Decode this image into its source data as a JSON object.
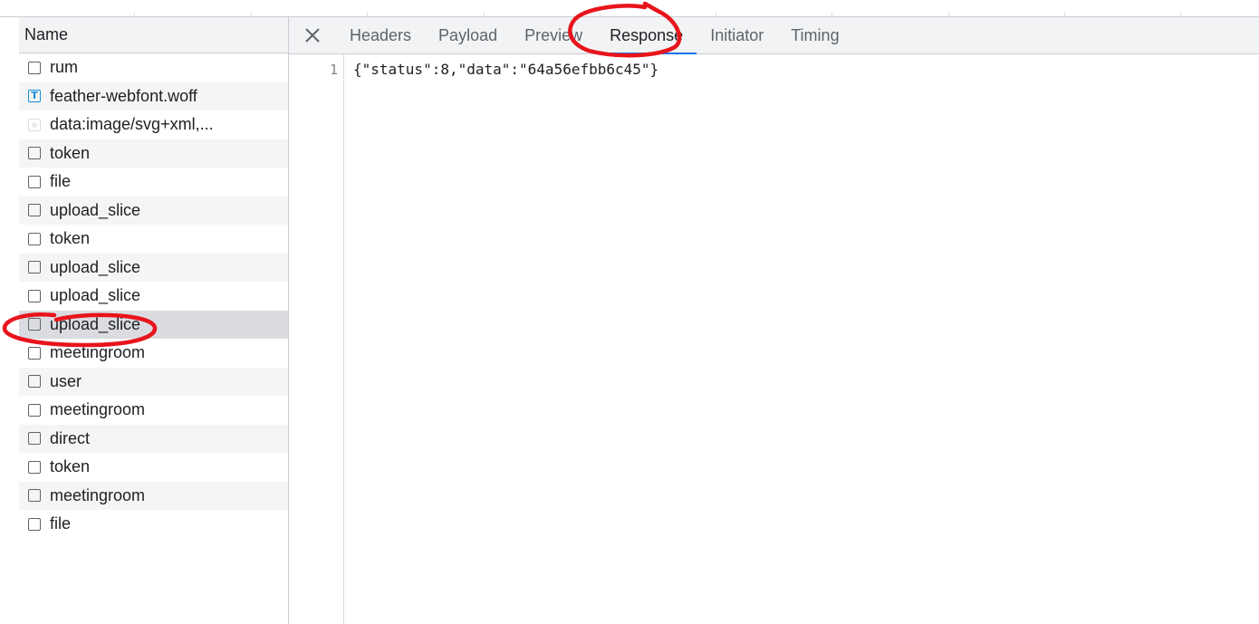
{
  "request_list": {
    "header": "Name",
    "items": [
      {
        "name": "rum",
        "icon": "document-icon",
        "selected": false
      },
      {
        "name": "feather-webfont.woff",
        "icon": "font-icon",
        "selected": false
      },
      {
        "name": "data:image/svg+xml,...",
        "icon": "image-icon",
        "selected": false
      },
      {
        "name": "token",
        "icon": "document-icon",
        "selected": false
      },
      {
        "name": "file",
        "icon": "document-icon",
        "selected": false
      },
      {
        "name": "upload_slice",
        "icon": "document-icon",
        "selected": false
      },
      {
        "name": "token",
        "icon": "document-icon",
        "selected": false
      },
      {
        "name": "upload_slice",
        "icon": "document-icon",
        "selected": false
      },
      {
        "name": "upload_slice",
        "icon": "document-icon",
        "selected": false
      },
      {
        "name": "upload_slice",
        "icon": "document-icon",
        "selected": true
      },
      {
        "name": "meetingroom",
        "icon": "document-icon",
        "selected": false
      },
      {
        "name": "user",
        "icon": "document-icon",
        "selected": false
      },
      {
        "name": "meetingroom",
        "icon": "document-icon",
        "selected": false
      },
      {
        "name": "direct",
        "icon": "document-icon",
        "selected": false
      },
      {
        "name": "token",
        "icon": "document-icon",
        "selected": false
      },
      {
        "name": "meetingroom",
        "icon": "document-icon",
        "selected": false
      },
      {
        "name": "file",
        "icon": "document-icon",
        "selected": false
      }
    ]
  },
  "details": {
    "close_icon": "close-icon",
    "tabs": [
      {
        "label": "Headers",
        "active": false
      },
      {
        "label": "Payload",
        "active": false
      },
      {
        "label": "Preview",
        "active": false
      },
      {
        "label": "Response",
        "active": true
      },
      {
        "label": "Initiator",
        "active": false
      },
      {
        "label": "Timing",
        "active": false
      }
    ],
    "response": {
      "line_number": "1",
      "content": "{\"status\":8,\"data\":\"64a56efbb6c45\"}"
    }
  },
  "colors": {
    "active_tab_underline": "#1a73e8",
    "annotation": "#e8141c",
    "selected_row": "#dadce2"
  }
}
